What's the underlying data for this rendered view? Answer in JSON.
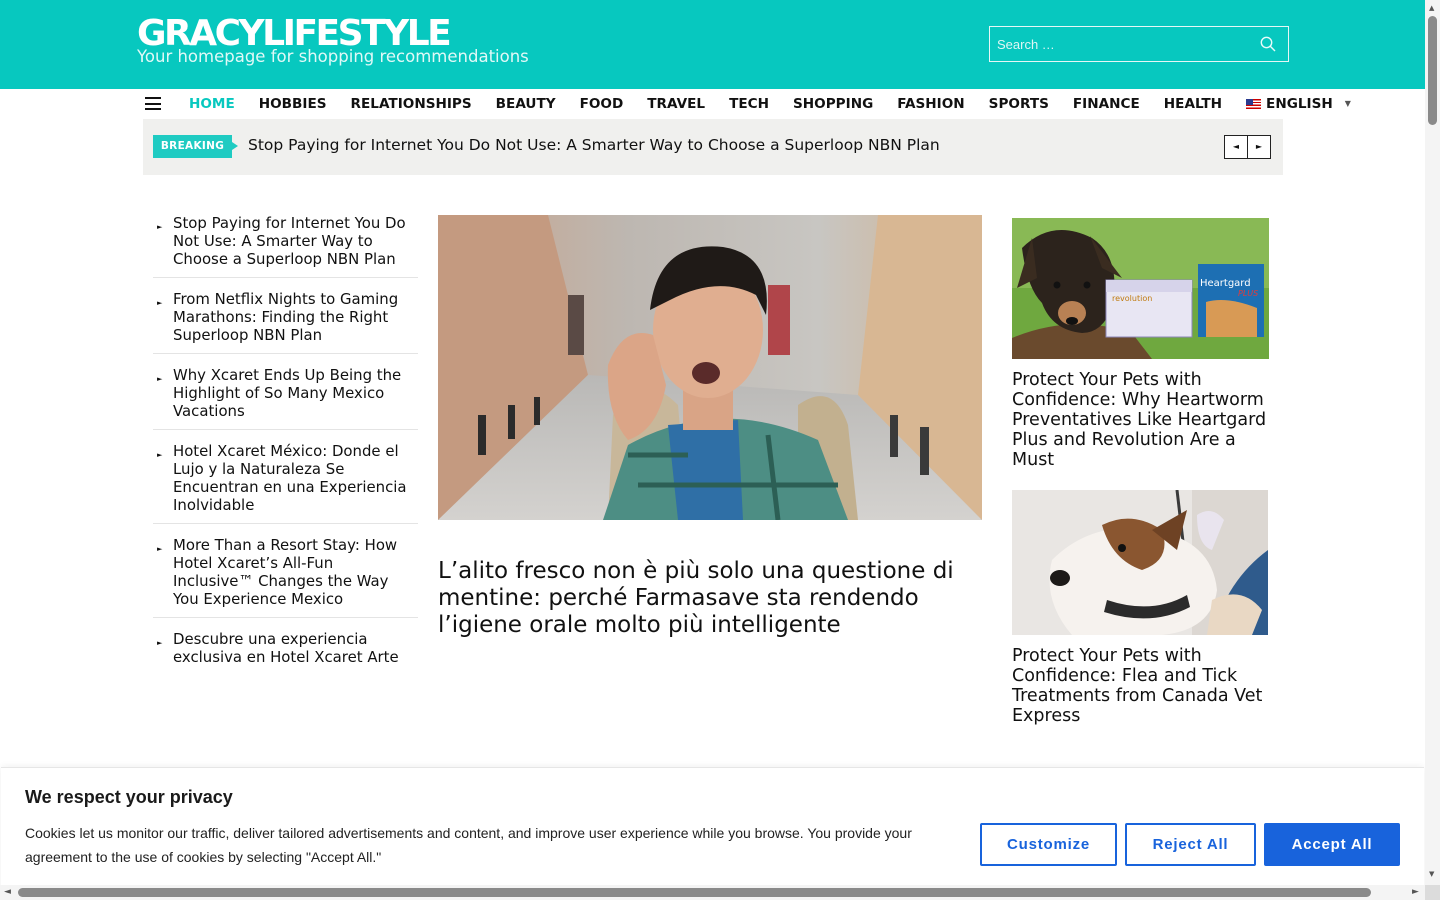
{
  "brand": {
    "logo_part1": "GRACY",
    "logo_part2": "LIFESTYLE",
    "tagline": "Your homepage for shopping recommendations"
  },
  "search": {
    "placeholder": "Search …"
  },
  "nav": {
    "items": [
      "HOME",
      "HOBBIES",
      "RELATIONSHIPS",
      "BEAUTY",
      "FOOD",
      "TRAVEL",
      "TECH",
      "SHOPPING",
      "FASHION",
      "SPORTS",
      "FINANCE",
      "HEALTH"
    ],
    "active": "HOME",
    "language": "ENGLISH"
  },
  "breaking": {
    "badge": "BREAKING",
    "headline": "Stop Paying for Internet You Do Not Use: A Smarter Way to Choose a Superloop NBN Plan",
    "prev_icon": "◄",
    "next_icon": "►"
  },
  "left_list": [
    "Stop Paying for Internet You Do Not Use: A Smarter Way to Choose a Superloop NBN Plan",
    "From Netflix Nights to Gaming Marathons: Finding the Right Superloop NBN Plan",
    "Why Xcaret Ends Up Being the Highlight of So Many Mexico Vacations",
    "Hotel Xcaret México: Donde el Lujo y la Naturaleza Se Encuentran en una Experiencia Inolvidable",
    "More Than a Resort Stay: How Hotel Xcaret’s All-Fun Inclusive™ Changes the Way You Experience Mexico",
    "Descubre una experiencia exclusiva en Hotel Xcaret Arte"
  ],
  "feature": {
    "title": "L’alito fresco non è più solo una questione di mentine: perché Farmasave sta rendendo l’igiene orale molto più intelligente"
  },
  "right_cards": [
    {
      "title": "Protect Your Pets with Confidence: Why Heartworm Preventatives Like Heartgard Plus and Revolution Are a Must",
      "package_labels": [
        "revolution",
        "Heartgard",
        "PLUS"
      ]
    },
    {
      "title": "Protect Your Pets with Confidence: Flea and Tick Treatments from Canada Vet Express"
    }
  ],
  "cookie": {
    "title": "We respect your privacy",
    "text": "Cookies let us monitor our traffic, deliver tailored advertisements and content, and improve user experience while you browse. You provide your agreement to the use of cookies by selecting \"Accept All.\"",
    "customize": "Customize",
    "reject": "Reject All",
    "accept": "Accept All"
  },
  "colors": {
    "brand_teal": "#07c8bf",
    "accept_blue": "#1863dc"
  }
}
